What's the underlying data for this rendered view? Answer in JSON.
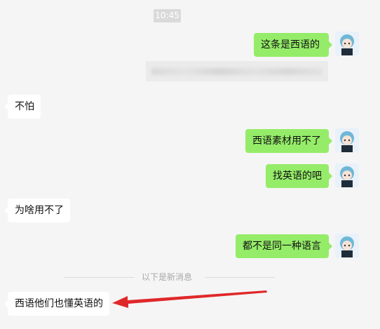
{
  "timestamp": "10:45",
  "messages": {
    "m1": "这条是西语的",
    "m2": "不怕",
    "m3": "西语素材用不了",
    "m4": "找英语的吧",
    "m5": "为啥用不了",
    "m6": "都不是同一种语言",
    "m7": "西语他们也懂英语的"
  },
  "divider_label": "以下是新消息",
  "colors": {
    "outgoing_bubble": "#95ec69",
    "incoming_bubble": "#ffffff",
    "background": "#f5f5f5",
    "arrow": "#e0282a"
  },
  "icons": {
    "avatar": "anime-avatar-icon",
    "arrow": "red-arrow-annotation"
  }
}
